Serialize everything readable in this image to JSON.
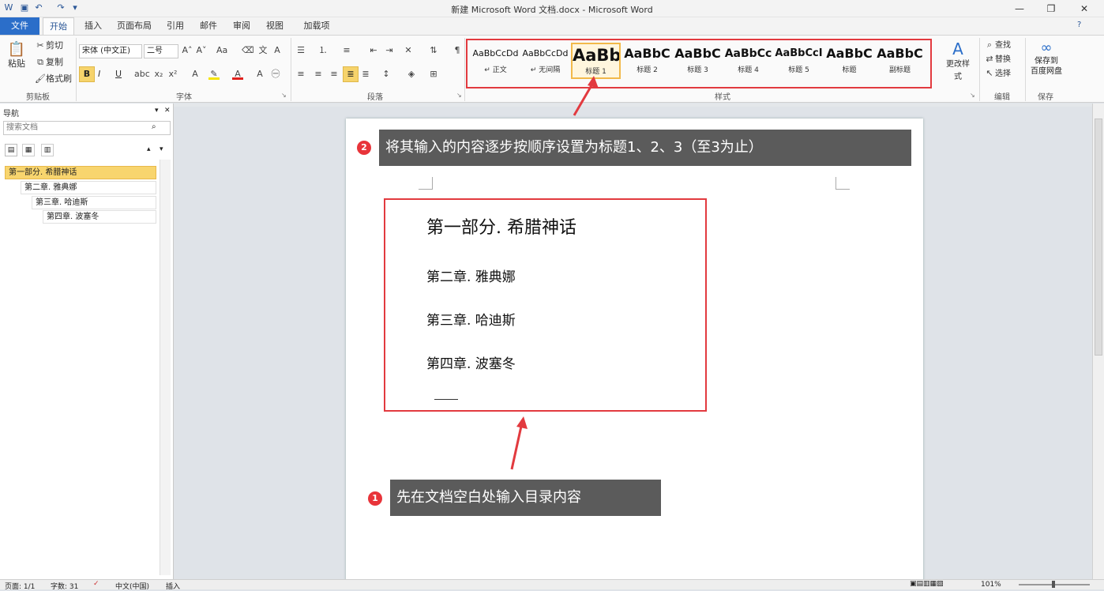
{
  "window": {
    "title": "新建 Microsoft Word 文档.docx - Microsoft Word"
  },
  "qat": {
    "save_icon": "save-icon",
    "undo_icon": "undo-icon",
    "redo_icon": "redo-icon"
  },
  "tabs": {
    "file": "文件",
    "items": [
      "开始",
      "插入",
      "页面布局",
      "引用",
      "邮件",
      "审阅",
      "视图",
      "加载项"
    ]
  },
  "clipboard": {
    "paste": "粘贴",
    "cut": "剪切",
    "copy": "复制",
    "format_painter": "格式刷",
    "group": "剪贴板"
  },
  "font": {
    "name": "宋体 (中文正)",
    "size": "二号",
    "group": "字体",
    "bold": "B",
    "italic": "I",
    "underline": "U"
  },
  "paragraph": {
    "group": "段落"
  },
  "styles": {
    "group": "样式",
    "items": [
      {
        "preview": "AaBbCcDd",
        "name": "↵ 正文"
      },
      {
        "preview": "AaBbCcDd",
        "name": "↵ 无间隔"
      },
      {
        "preview": "AaBb",
        "name": "标题 1"
      },
      {
        "preview": "AaBbC",
        "name": "标题 2"
      },
      {
        "preview": "AaBbC",
        "name": "标题 3"
      },
      {
        "preview": "AaBbCc",
        "name": "标题 4"
      },
      {
        "preview": "AaBbCcI",
        "name": "标题 5"
      },
      {
        "preview": "AaBbC",
        "name": "标题"
      },
      {
        "preview": "AaBbC",
        "name": "副标题"
      }
    ],
    "change_styles": "更改样式"
  },
  "editing": {
    "group": "编辑",
    "find": "查找",
    "replace": "替换",
    "select": "选择"
  },
  "save_group": {
    "label_line1": "保存到",
    "label_line2": "百度网盘",
    "group": "保存"
  },
  "nav": {
    "title": "导航",
    "search_placeholder": "搜索文档",
    "items": [
      "第一部分. 希腊神话",
      "第二章. 雅典娜",
      "第三章. 哈迪斯",
      "第四章. 波塞冬"
    ]
  },
  "doc": {
    "lines": [
      "第一部分. 希腊神话",
      "第二章. 雅典娜",
      "第三章. 哈迪斯",
      "第四章. 波塞冬"
    ],
    "callout_top": "将其输入的内容逐步按顺序设置为标题1、2、3（至3为止）",
    "callout_bottom": "先在文档空白处输入目录内容",
    "colors": {
      "callout": "#5b5b5b",
      "annotation_red": "#e23a3f"
    }
  },
  "status": {
    "page": "页面: 1/1",
    "words": "字数: 31",
    "language": "中文(中国)",
    "mode": "插入",
    "zoom": "101%"
  }
}
